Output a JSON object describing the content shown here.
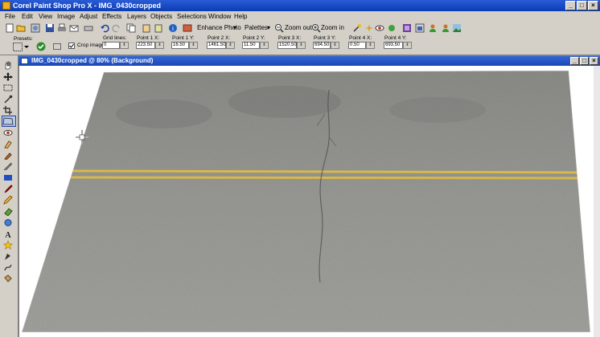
{
  "app": {
    "title": "Corel Paint Shop Pro X - IMG_0430cropped",
    "window_buttons": [
      "_",
      "□",
      "×"
    ]
  },
  "menu": [
    "File",
    "Edit",
    "View",
    "Image",
    "Adjust",
    "Effects",
    "Layers",
    "Objects",
    "Selections",
    "Window",
    "Help"
  ],
  "toolbar": {
    "enhance_photo": "Enhance Photo",
    "palettes": "Palettes",
    "zoom_out": "Zoom out",
    "zoom_in": "Zoom in"
  },
  "options": {
    "presets_label": "Presets:",
    "crop_image_label": "Crop image",
    "grid_lines_label": "Grid lines:",
    "grid_lines_value": "0",
    "point1x_label": "Point 1 X:",
    "point1x_value": "223.50",
    "point1y_label": "Point 1 Y:",
    "point1y_value": "16.50",
    "point2x_label": "Point 2 X:",
    "point2x_value": "1461.50",
    "point2y_label": "Point 2 Y:",
    "point2y_value": "11.50",
    "point3x_label": "Point 3 X:",
    "point3x_value": "1520.50",
    "point3y_label": "Point 3 Y:",
    "point3y_value": "694.50",
    "point4x_label": "Point 4 X:",
    "point4x_value": "0.50",
    "point4y_label": "Point 4 Y:",
    "point4y_value": "693.50"
  },
  "document": {
    "title": "IMG_0430cropped @ 80% (Background)"
  },
  "colors": {
    "title_blue": "#0a3db3",
    "road_gray": "#8e8e8a",
    "lane_yellow": "#d8b84a",
    "arrow_red": "#d0201c"
  }
}
